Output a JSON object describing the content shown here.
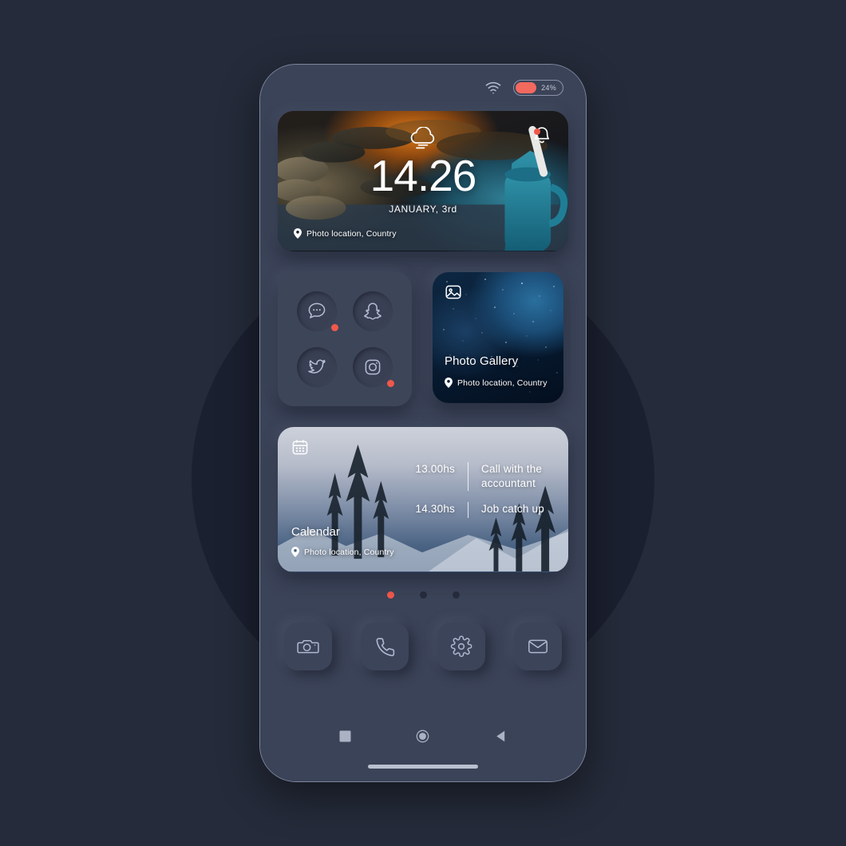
{
  "status_bar": {
    "wifi_icon": "wifi-icon",
    "battery_level": "24%",
    "battery_icon": "battery-icon"
  },
  "clock_widget": {
    "time": "14.26",
    "date": "JANUARY, 3rd",
    "location": "Photo location, Country",
    "weather_icon": "cloud-fog-icon",
    "bell_icon": "bell-icon",
    "has_notification": true
  },
  "social_widget": {
    "icons": [
      {
        "name": "messages-icon",
        "label": "Messages",
        "badge": true
      },
      {
        "name": "snapchat-icon",
        "label": "Snapchat",
        "badge": false
      },
      {
        "name": "twitter-icon",
        "label": "Twitter",
        "badge": false
      },
      {
        "name": "instagram-icon",
        "label": "Instagram",
        "badge": true
      }
    ]
  },
  "gallery_widget": {
    "title": "Photo Gallery",
    "location": "Photo location, Country",
    "icon": "image-icon"
  },
  "calendar_widget": {
    "title": "Calendar",
    "location": "Photo location, Country",
    "icon": "calendar-icon",
    "events": [
      {
        "time": "13.00hs",
        "title": "Call with the accountant"
      },
      {
        "time": "14.30hs",
        "title": "Job catch up"
      }
    ]
  },
  "page_dots": {
    "count": 3,
    "active_index": 0
  },
  "dock": {
    "items": [
      {
        "name": "camera-icon",
        "label": "Camera"
      },
      {
        "name": "phone-icon",
        "label": "Phone"
      },
      {
        "name": "settings-icon",
        "label": "Settings"
      },
      {
        "name": "mail-icon",
        "label": "Mail"
      }
    ]
  },
  "nav_bar": {
    "recents_label": "Recents",
    "home_label": "Home",
    "back_label": "Back"
  },
  "colors": {
    "page_background": "#252b3a",
    "backdrop_circle": "#1b2030",
    "phone_surface": "#3b4358",
    "accent_red": "#f0584b",
    "icon_stroke": "#aeb8cf"
  }
}
